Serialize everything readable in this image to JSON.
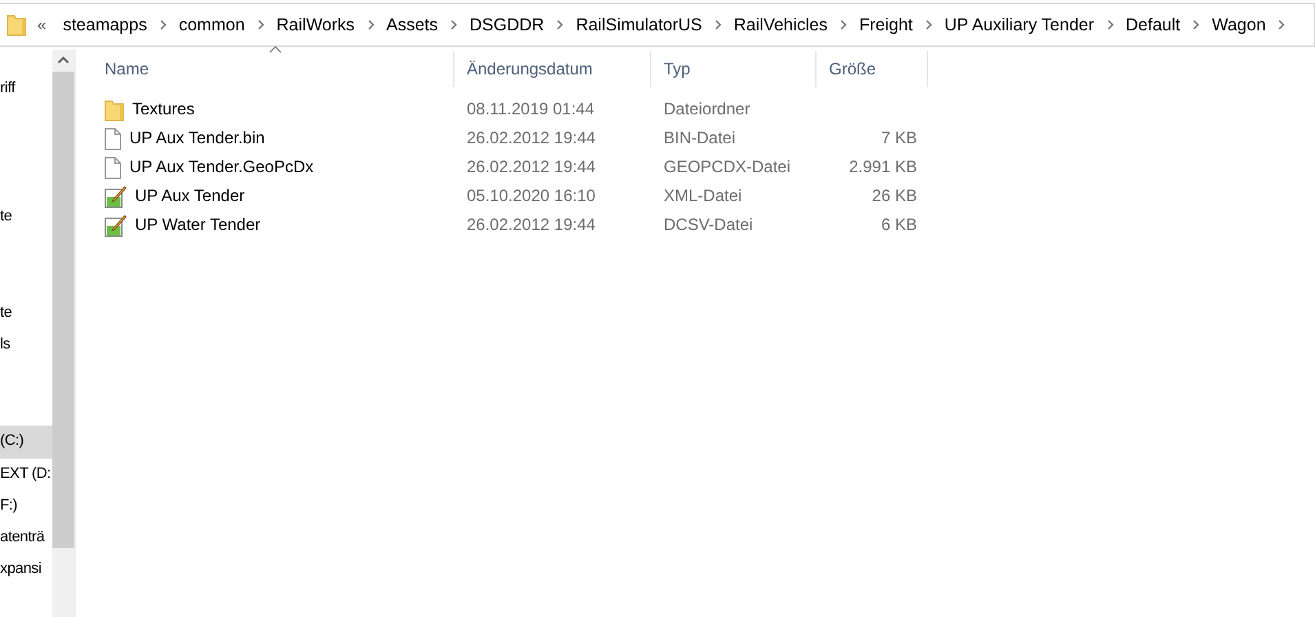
{
  "address_bar": {
    "overflow": "«",
    "path": [
      "steamapps",
      "common",
      "RailWorks",
      "Assets",
      "DSGDDR",
      "RailSimulatorUS",
      "RailVehicles",
      "Freight",
      "UP Auxiliary Tender",
      "Default",
      "Wagon"
    ]
  },
  "navigation_pane": {
    "items": [
      {
        "label": "riff",
        "selected": false
      },
      {
        "label": "te",
        "selected": false
      },
      {
        "label": "te",
        "selected": false
      },
      {
        "label": "ls",
        "selected": false
      },
      {
        "label": "(C:)",
        "selected": true
      },
      {
        "label": "EXT (D:",
        "selected": false
      },
      {
        "label": "F:)",
        "selected": false
      },
      {
        "label": "atenträ",
        "selected": false
      },
      {
        "label": "xpansi",
        "selected": false
      }
    ]
  },
  "file_list": {
    "columns": [
      "Name",
      "Änderungsdatum",
      "Typ",
      "Größe"
    ],
    "rows": [
      {
        "kind": "folder",
        "name": "Textures",
        "date": "08.11.2019 01:44",
        "type": "Dateiordner"
      },
      {
        "kind": "file",
        "name": "UP Aux Tender.bin",
        "date": "26.02.2012 19:44",
        "type": "BIN-Datei",
        "size": "7 KB"
      },
      {
        "kind": "file",
        "name": "UP Aux Tender.GeoPcDx",
        "date": "26.02.2012 19:44",
        "type": "GEOPCDX-Datei",
        "size": "2.991 KB"
      },
      {
        "kind": "editable",
        "name": "UP Aux Tender",
        "date": "05.10.2020 16:10",
        "type": "XML-Datei",
        "size": "26 KB"
      },
      {
        "kind": "editable",
        "name": "UP Water Tender",
        "date": "26.02.2012 19:44",
        "type": "DCSV-Datei",
        "size": "6 KB"
      }
    ]
  }
}
